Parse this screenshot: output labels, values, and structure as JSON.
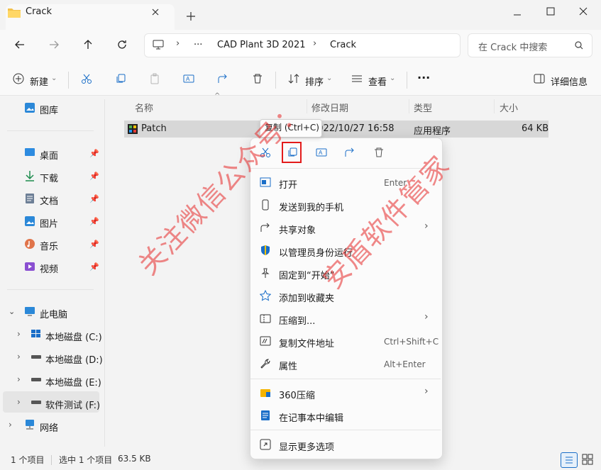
{
  "window": {
    "tab_title": "Crack",
    "icons": [
      "folder-icon",
      "close-icon",
      "plus-icon",
      "minimize-icon",
      "maximize-icon",
      "close-icon"
    ]
  },
  "address": {
    "ellipsis": "···",
    "crumbs": [
      "CAD Plant 3D 2021",
      "Crack"
    ],
    "search_placeholder": "在 Crack 中搜索"
  },
  "toolbar": {
    "new_label": "新建",
    "sort_label": "排序",
    "view_label": "查看",
    "more_label": "···",
    "details_label": "详细信息"
  },
  "sidebar": {
    "gallery": "图库",
    "quick": [
      "桌面",
      "下载",
      "文档",
      "图片",
      "音乐",
      "视频"
    ],
    "this_pc": "此电脑",
    "drives": [
      "本地磁盘 (C:)",
      "本地磁盘 (D:)",
      "本地磁盘 (E:)",
      "软件测试 (F:)"
    ],
    "network": "网络"
  },
  "columns": {
    "name": "名称",
    "modified": "修改日期",
    "type": "类型",
    "size": "大小"
  },
  "file": {
    "name": "Patch",
    "modified": "2022/10/27 16:58",
    "type": "应用程序",
    "size": "64 KB"
  },
  "tooltip": "复制 (Ctrl+C)",
  "context_menu": {
    "items": [
      {
        "label": "打开",
        "shortcut": "Enter"
      },
      {
        "label": "发送到我的手机",
        "shortcut": ""
      },
      {
        "label": "共享对象",
        "shortcut": ""
      },
      {
        "label": "以管理员身份运行",
        "shortcut": ""
      },
      {
        "label": "固定到“开始”",
        "shortcut": ""
      },
      {
        "label": "添加到收藏夹",
        "shortcut": ""
      },
      {
        "label": "压缩到...",
        "shortcut": ""
      },
      {
        "label": "复制文件地址",
        "shortcut": "Ctrl+Shift+C"
      },
      {
        "label": "属性",
        "shortcut": "Alt+Enter"
      }
    ],
    "extra": [
      {
        "label": "360压缩"
      },
      {
        "label": "在记事本中编辑"
      }
    ],
    "more": "显示更多选项"
  },
  "status": {
    "count": "1 个项目",
    "selected": "选中 1 个项目",
    "size": "63.5 KB"
  },
  "watermark": {
    "left": "关注微信公众号：",
    "right": "安盾软件管家"
  },
  "colors": {
    "accent": "#0067c0",
    "highlight": "#e31b1b",
    "selection": "#d7d7d7"
  }
}
